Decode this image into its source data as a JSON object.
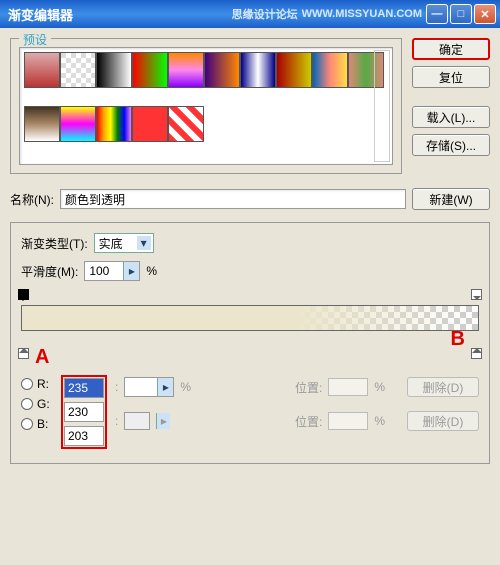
{
  "titlebar": {
    "title": "渐变编辑器",
    "watermark1": "思缘设计论坛",
    "watermark2": "WWW.MISSYUAN.COM"
  },
  "winbtns": {
    "min": "—",
    "max": "□",
    "close": "✕"
  },
  "presets": {
    "legend": "预设"
  },
  "buttons": {
    "ok": "确定",
    "reset": "复位",
    "load": "载入(L)...",
    "save": "存储(S)...",
    "new": "新建(W)"
  },
  "name": {
    "label": "名称(N):",
    "value": "颜色到透明"
  },
  "gradtype": {
    "label": "渐变类型(T):",
    "value": "实底"
  },
  "smooth": {
    "label": "平滑度(M):",
    "value": "100",
    "pct": "%"
  },
  "markers": {
    "a": "A",
    "b": "B"
  },
  "rgb": {
    "r_label": "R:",
    "g_label": "G:",
    "b_label": "B:",
    "r": "235",
    "g": "230",
    "b": "203"
  },
  "row1": {
    "opacity_label": ":",
    "pct": "%",
    "pos_label": "位置:",
    "del": "删除(D)"
  },
  "row2": {
    "color_label": ":",
    "pos_label": "位置:",
    "pct": "%",
    "del": "删除(D)"
  }
}
